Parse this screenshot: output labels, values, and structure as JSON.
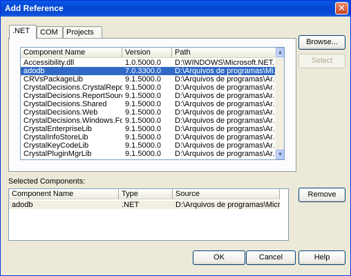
{
  "window": {
    "title": "Add Reference",
    "close_glyph": "✕"
  },
  "tabs": [
    {
      "label": ".NET",
      "active": true
    },
    {
      "label": "COM",
      "active": false
    },
    {
      "label": "Projects",
      "active": false
    }
  ],
  "components_table": {
    "columns": [
      "Component Name",
      "Version",
      "Path"
    ],
    "rows": [
      {
        "name": "Accessibility.dll",
        "version": "1.0.5000.0",
        "path": "D:\\WINDOWS\\Microsoft.NET...",
        "selected": false
      },
      {
        "name": "adodb",
        "version": "7.0.3300.0",
        "path": "D:\\Arquivos de programas\\Mi...",
        "selected": true
      },
      {
        "name": "CRVsPackageLib",
        "version": "9.1.5000.0",
        "path": "D:\\Arquivos de programas\\Ar...",
        "selected": false
      },
      {
        "name": "CrystalDecisions.CrystalRepo...",
        "version": "9.1.5000.0",
        "path": "D:\\Arquivos de programas\\Ar...",
        "selected": false
      },
      {
        "name": "CrystalDecisions.ReportSource",
        "version": "9.1.5000.0",
        "path": "D:\\Arquivos de programas\\Ar...",
        "selected": false
      },
      {
        "name": "CrystalDecisions.Shared",
        "version": "9.1.5000.0",
        "path": "D:\\Arquivos de programas\\Ar...",
        "selected": false
      },
      {
        "name": "CrystalDecisions.Web",
        "version": "9.1.5000.0",
        "path": "D:\\Arquivos de programas\\Ar...",
        "selected": false
      },
      {
        "name": "CrystalDecisions.Windows.Fo...",
        "version": "9.1.5000.0",
        "path": "D:\\Arquivos de programas\\Ar...",
        "selected": false
      },
      {
        "name": "CrystalEnterpriseLib",
        "version": "9.1.5000.0",
        "path": "D:\\Arquivos de programas\\Ar...",
        "selected": false
      },
      {
        "name": "CrystalInfoStoreLib",
        "version": "9.1.5000.0",
        "path": "D:\\Arquivos de programas\\Ar...",
        "selected": false
      },
      {
        "name": "CrystalKeyCodeLib",
        "version": "9.1.5000.0",
        "path": "D:\\Arquivos de programas\\Ar...",
        "selected": false
      },
      {
        "name": "CrystalPluginMgrLib",
        "version": "9.1.5000.0",
        "path": "D:\\Arquivos de programas\\Ar...",
        "selected": false
      }
    ]
  },
  "buttons": {
    "browse": "Browse...",
    "select": "Select",
    "remove": "Remove",
    "ok": "OK",
    "cancel": "Cancel",
    "help": "Help"
  },
  "selected_components": {
    "label": "Selected Components:",
    "columns": [
      "Component Name",
      "Type",
      "Source"
    ],
    "rows": [
      {
        "name": "adodb",
        "type": ".NET",
        "source": "D:\\Arquivos de programas\\Micr..."
      }
    ]
  },
  "scroll_icons": {
    "up": "up-arrow-icon",
    "down": "down-arrow-icon"
  }
}
